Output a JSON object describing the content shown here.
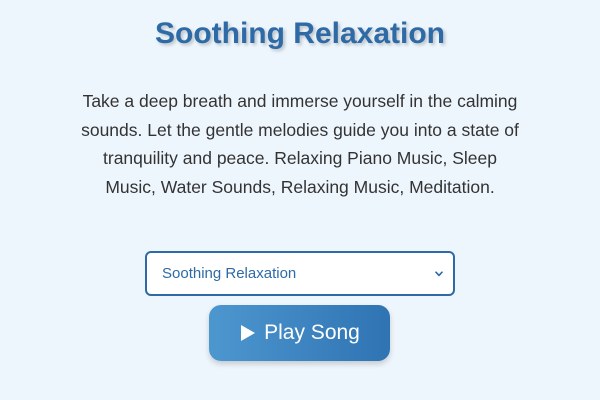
{
  "header": {
    "title": "Soothing Relaxation"
  },
  "main": {
    "description": "Take a deep breath and immerse yourself in the calming sounds. Let the gentle melodies guide you into a state of tranquility and peace. Relaxing Piano Music, Sleep Music, Water Sounds, Relaxing Music, Meditation."
  },
  "song_select": {
    "selected": "Soothing Relaxation",
    "icon": "chevron-down-icon"
  },
  "play_button": {
    "label": "Play Song",
    "icon": "play-icon"
  },
  "colors": {
    "background": "#eef6fd",
    "accent": "#2d6aa6",
    "button_gradient_start": "#4d97cf",
    "button_gradient_end": "#2f73b3",
    "body_text": "#333333"
  }
}
